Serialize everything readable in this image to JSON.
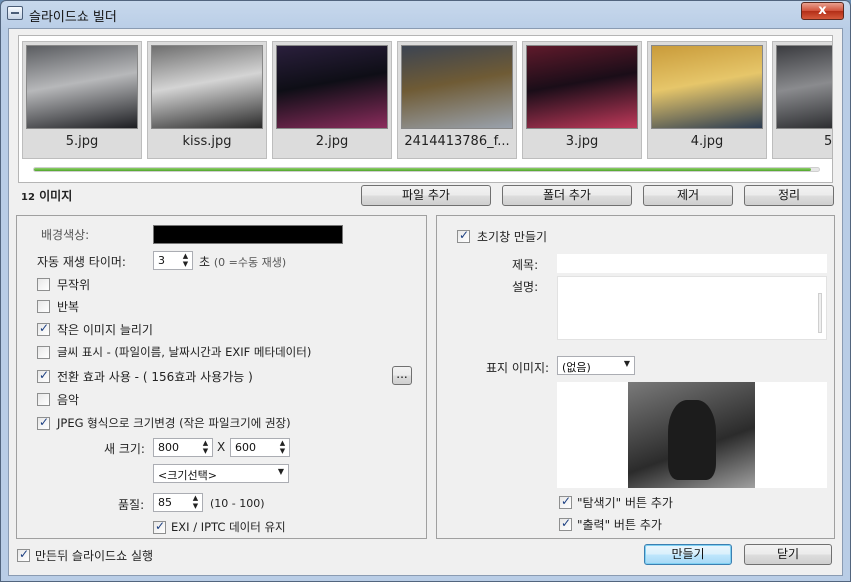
{
  "window": {
    "title": "슬라이드쇼 빌더",
    "close": "x"
  },
  "gallery": {
    "thumbs": [
      {
        "caption": "5.jpg",
        "colors": [
          "#5b5d61",
          "#1d1e22",
          "#b7b8ba"
        ]
      },
      {
        "caption": "kiss.jpg",
        "colors": [
          "#6f6f6f",
          "#2a2a2a",
          "#d4d4d4"
        ]
      },
      {
        "caption": "2.jpg",
        "colors": [
          "#2a1f3c",
          "#8b2c5c",
          "#0e0e16"
        ]
      },
      {
        "caption": "2414413786_f...",
        "colors": [
          "#3c4452",
          "#9aa2ad",
          "#6f5b35"
        ]
      },
      {
        "caption": "3.jpg",
        "colors": [
          "#5f1a2b",
          "#c0395a",
          "#1a0d18"
        ]
      },
      {
        "caption": "4.jpg",
        "colors": [
          "#c99b3a",
          "#2c3c52",
          "#e6c66a"
        ]
      },
      {
        "caption": "5.j",
        "colors": [
          "#3b3c40",
          "#1a1b1e",
          "#8a8b8e"
        ]
      }
    ],
    "progress": 0.99
  },
  "image_count": {
    "number": "12",
    "label": "이미지"
  },
  "toolbar": {
    "add_file": "파일 추가",
    "add_folder": "폴더 추가",
    "remove": "제거",
    "sort": "정리"
  },
  "left": {
    "bg_color_label": "배경색상:",
    "bg_color": "#000000",
    "timer_label": "자동 재생 타이머:",
    "timer_value": "3",
    "timer_unit": "초",
    "timer_hint": "(0 =수동 재생)",
    "random": "무작위",
    "repeat": "반복",
    "stretch": "작은 이미지 늘리기",
    "show_text": "글씨 표시 - (파일이름, 날짜시간과 EXIF 메타데이터)",
    "transitions": "전환 효과 사용 - ( 156효과 사용가능 )",
    "ellipsis": "...",
    "music": "음악",
    "jpeg_resize": "JPEG 형식으로 크기변경 (작은 파일크기에 권장)",
    "new_size_label": "새 크기:",
    "width": "800",
    "times": "X",
    "height": "600",
    "size_select": "<크기선택>",
    "quality_label": "품질:",
    "quality": "85",
    "quality_range": "(10 - 100)",
    "keep_exif": "EXI / IPTC 데이터 유지"
  },
  "right": {
    "create_start": "초기창 만들기",
    "title_label": "제목:",
    "desc_label": "설명:",
    "cover_label": "표지 이미지:",
    "cover_value": "(없음)",
    "add_explorer": "\"탐색기\" 버튼 추가",
    "add_print": "\"출력\" 버튼 추가"
  },
  "footer": {
    "run_after": "만든뒤 슬라이드쇼 실행",
    "create": "만들기",
    "close": "닫기"
  }
}
